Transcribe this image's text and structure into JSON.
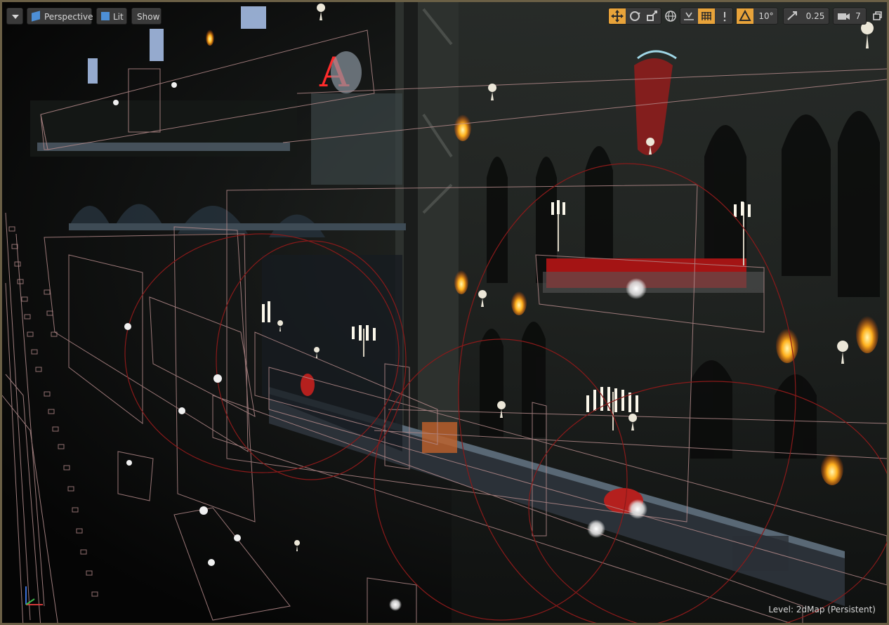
{
  "toolbar": {
    "menu_label": "",
    "view_mode_label": "Perspective",
    "lighting_label": "Lit",
    "show_label": "Show",
    "rotation_snap": "10°",
    "scale_snap": "0.25",
    "camera_speed": "7"
  },
  "status": {
    "level_prefix": "Level:",
    "level_name": "2dMap (Persistent)"
  },
  "colors": {
    "accent_orange": "#e8a33a",
    "toolbar_bg": "#3a3a3a",
    "viewport_border": "#6b6046",
    "wire_pink": "#b48a8a",
    "light_radius_red": "#8a1a1a"
  },
  "icons": {
    "translate": "translate-icon",
    "rotate": "rotate-icon",
    "scale": "scale-icon",
    "world_local": "globe-icon",
    "surface_snap": "surface-snap-icon",
    "grid_snap": "grid-icon",
    "rotation_snap": "rotation-snap-icon",
    "scale_snap": "scale-snap-icon",
    "camera_speed": "camera-icon",
    "maximize": "maximize-icon"
  }
}
